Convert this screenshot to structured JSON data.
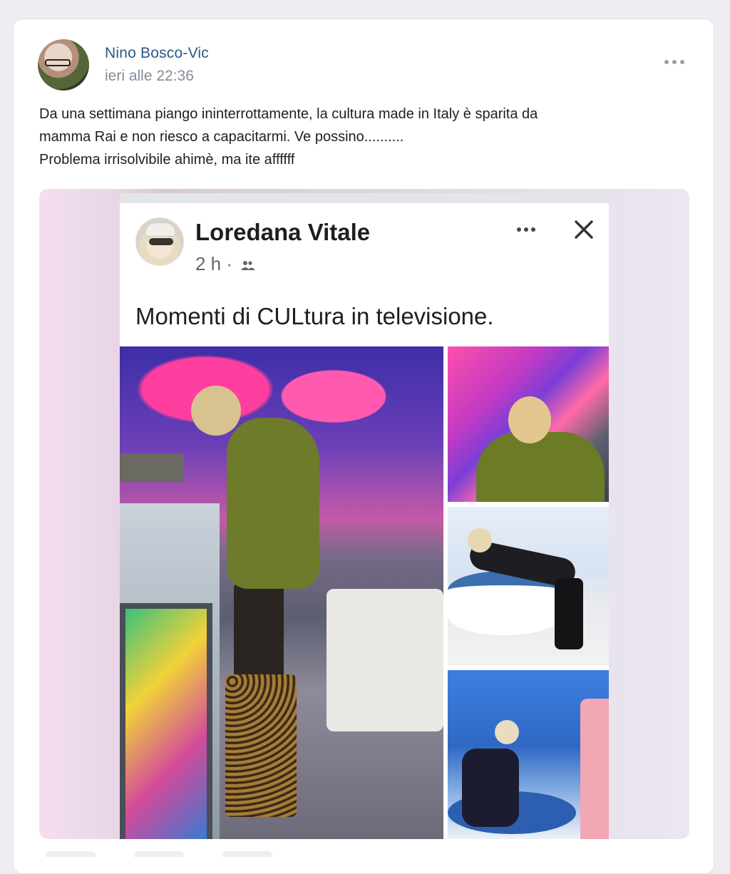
{
  "post": {
    "author": "Nino Bosco-Vic",
    "timestamp": "ieri alle 22:36",
    "text_lines": [
      "Da una settimana piango ininterrottamente, la cultura made in Italy è sparita da",
      "mamma Rai e non riesco a capacitarmi. Ve possino..........",
      "Problema irrisolvibile ahimè, ma ite affffff"
    ]
  },
  "shared_screenshot": {
    "author": "Loredana Vitale",
    "time": "2 h ·",
    "caption": "Momenti di CULtura in televisione.",
    "audience_icon": "friends-icon"
  },
  "icons": {
    "post_menu": "more-dots-icon",
    "inner_menu": "more-dots-icon",
    "inner_close": "close-icon"
  },
  "colors": {
    "author_link": "#2a5885",
    "timestamp": "#828b96",
    "background": "#eceef2"
  }
}
